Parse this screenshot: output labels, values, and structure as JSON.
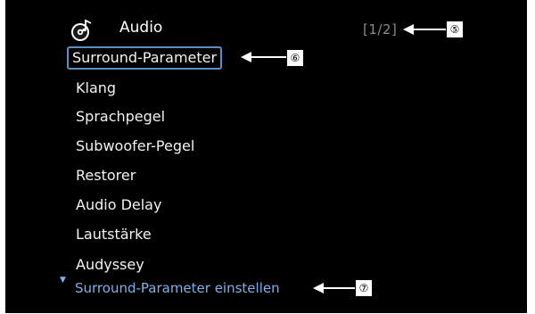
{
  "header": {
    "title": "Audio",
    "icon": "audio-disc-icon",
    "pager": "[1/2]"
  },
  "menu": {
    "items": [
      {
        "label": "Surround-Parameter",
        "selected": true
      },
      {
        "label": "Klang"
      },
      {
        "label": "Sprachpegel"
      },
      {
        "label": "Subwoofer-Pegel"
      },
      {
        "label": "Restorer"
      },
      {
        "label": "Audio Delay"
      },
      {
        "label": "Lautstärke"
      },
      {
        "label": "Audyssey"
      }
    ]
  },
  "footer": {
    "description": "Surround-Parameter einstellen"
  },
  "callouts": {
    "c5": "⑤",
    "c6": "⑥",
    "c7": "⑦"
  },
  "colors": {
    "background": "#000000",
    "selection_border": "#5b8fc6",
    "description_text": "#7fb0ea"
  }
}
